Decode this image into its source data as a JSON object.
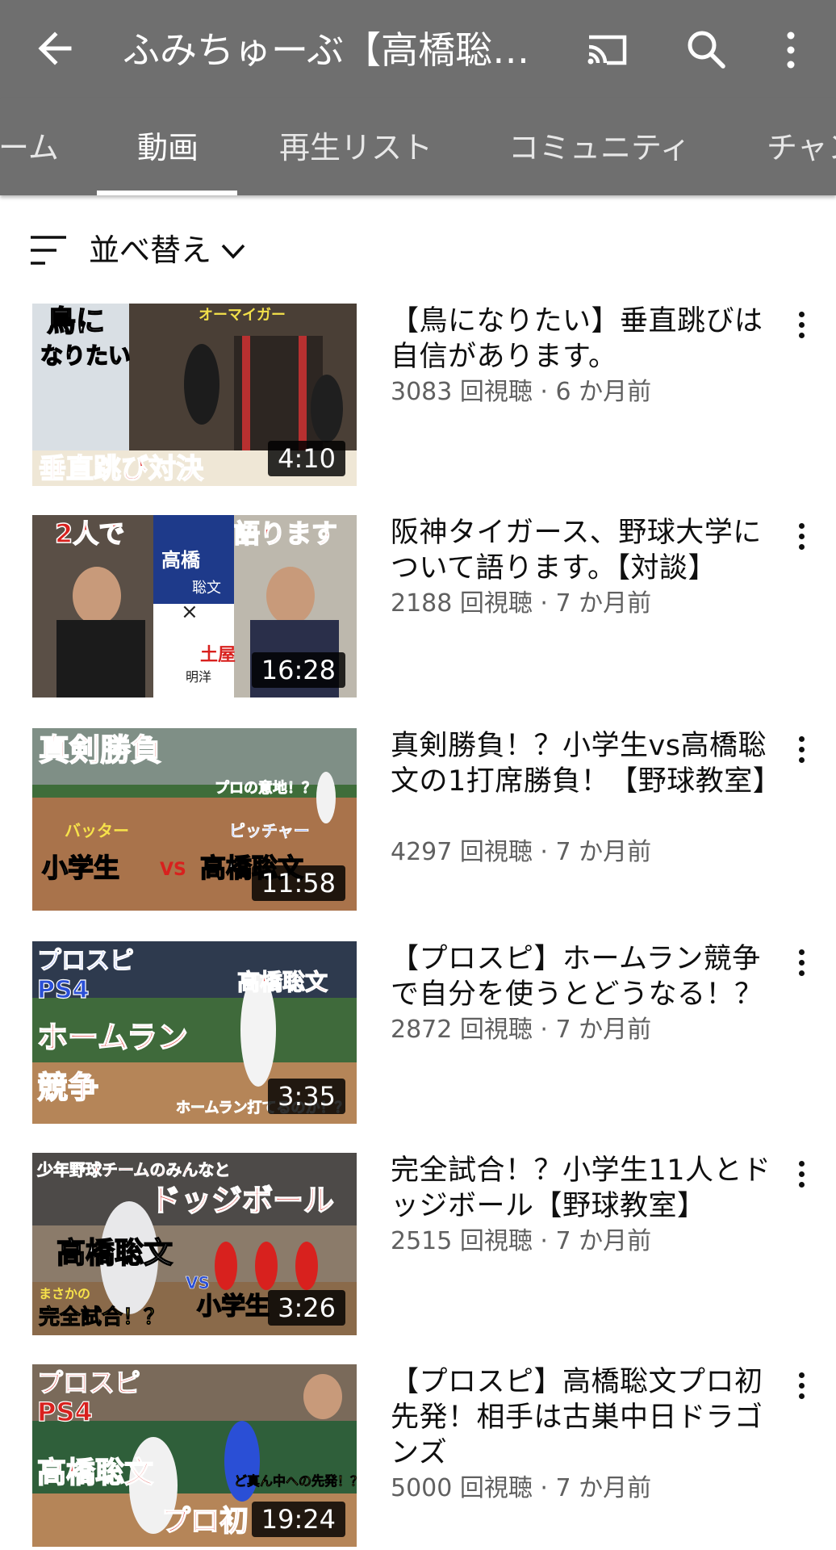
{
  "app_bar": {
    "title": "ふみちゅーぶ【高橋聡…"
  },
  "tabs": [
    {
      "label": "ーム",
      "active": false
    },
    {
      "label": "動画",
      "active": true
    },
    {
      "label": "再生リスト",
      "active": false
    },
    {
      "label": "コミュニティ",
      "active": false
    },
    {
      "label": "チャン",
      "active": false
    }
  ],
  "sort": {
    "label": "並べ替え"
  },
  "videos": [
    {
      "title": "【鳥になりたい】垂直跳びは自信があります。",
      "meta": "3083 回視聴 · 6 か月前",
      "duration": "4:10",
      "thumb_texts": [
        "鳥に",
        "なりたい",
        "オーマイガー",
        "垂直跳び対決"
      ]
    },
    {
      "title": "阪神タイガース、野球大学について語ります。【対談】",
      "meta": "2188 回視聴 · 7 か月前",
      "duration": "16:28",
      "thumb_texts": [
        "2人で",
        "語ります",
        "高橋",
        "聡文",
        "×",
        "土屋",
        "明洋"
      ]
    },
    {
      "title": "真剣勝負！？小学生vs高橋聡文の1打席勝負！【野球教室】",
      "meta": "4297 回視聴 · 7 か月前",
      "duration": "11:58",
      "thumb_texts": [
        "真剣勝負",
        "プロの意地！？",
        "バッター",
        "ピッチャー",
        "小学生",
        "VS",
        "高橋聡文"
      ]
    },
    {
      "title": "【プロスピ】ホームラン競争で自分を使うとどうなる！？",
      "meta": "2872 回視聴 · 7 か月前",
      "duration": "3:35",
      "thumb_texts": [
        "プロスピ",
        "PS4",
        "ホームラン",
        "競争",
        "高橋聡文",
        "ホームラン打てるのか！？"
      ]
    },
    {
      "title": "完全試合！？小学生11人とドッジボール【野球教室】",
      "meta": "2515 回視聴 · 7 か月前",
      "duration": "3:26",
      "thumb_texts": [
        "少年野球チームのみんなと",
        "ドッジボール",
        "高橋聡文",
        "VS",
        "小学生",
        "まさかの",
        "完全試合！？"
      ]
    },
    {
      "title": "【プロスピ】高橋聡文プロ初先発！相手は古巣中日ドラゴンズ",
      "meta": "5000 回視聴 · 7 か月前",
      "duration": "19:24",
      "thumb_texts": [
        "プロスピ",
        "PS4",
        "高橋聡文",
        "プロ初",
        "ど真ん中への先発！？"
      ]
    }
  ],
  "colors": {
    "app_bar": "#6f6f6f",
    "meta_text": "#606060",
    "thumb_red": "#d8211e"
  }
}
